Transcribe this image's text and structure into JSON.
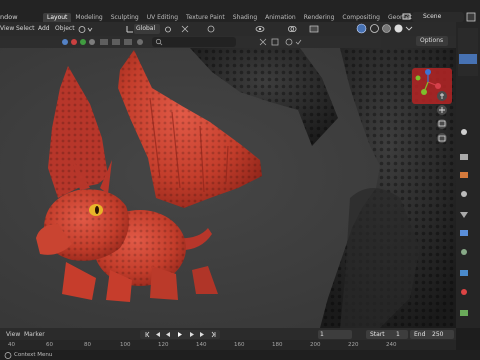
{
  "menubar": {
    "window_menu": "ndow",
    "workspaces": [
      "Layout",
      "Modeling",
      "Sculpting",
      "UV Editing",
      "Texture Paint",
      "Shading",
      "Animation",
      "Rendering",
      "Compositing",
      "Geometry Node"
    ],
    "active_workspace": "Layout",
    "scene_label": "Scene"
  },
  "viewport_header": {
    "view": "View",
    "select": "Select",
    "add": "Add",
    "object": "Object",
    "transform_orientation": "Global",
    "options_label": "Options"
  },
  "timeline": {
    "view": "View",
    "marker": "Marker",
    "current_frame": "1",
    "start_label": "Start",
    "start_value": "1",
    "end_label": "End",
    "end_value": "250",
    "ruler_ticks": [
      "40",
      "60",
      "80",
      "100",
      "120",
      "140",
      "160",
      "180",
      "200",
      "220",
      "240"
    ]
  },
  "statusbar": {
    "context_menu": "Context Menu"
  },
  "colors": {
    "accent": "#4772b3",
    "dragon_red": "#c9402e",
    "gizmo_x": "#d6404a",
    "gizmo_y": "#7fbf2c",
    "gizmo_z": "#3d73d4"
  }
}
